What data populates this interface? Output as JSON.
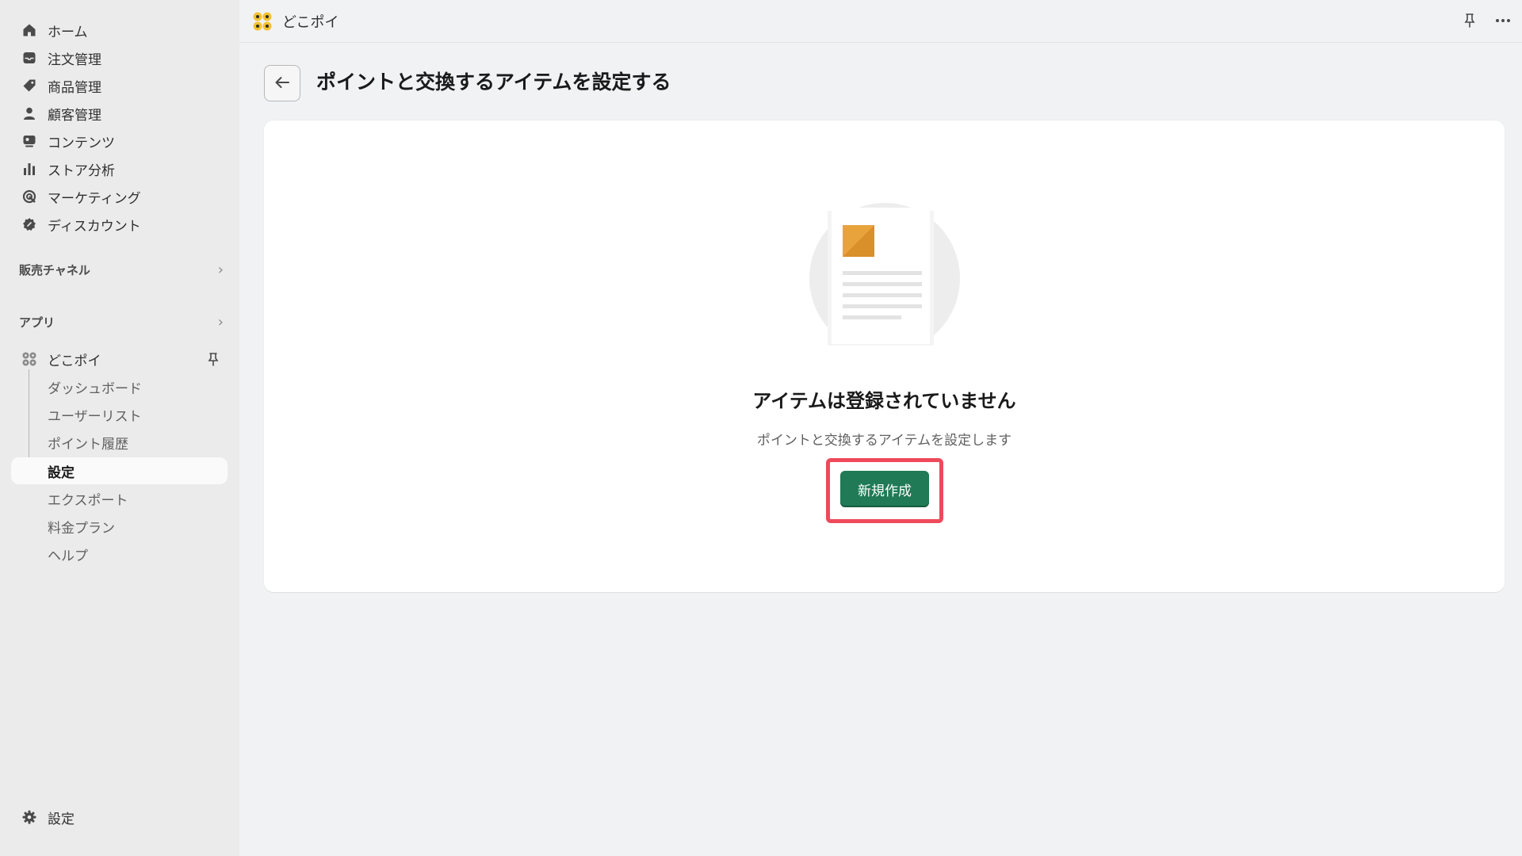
{
  "sidebar": {
    "nav": [
      {
        "label": "ホーム",
        "icon": "home-icon"
      },
      {
        "label": "注文管理",
        "icon": "inbox-icon"
      },
      {
        "label": "商品管理",
        "icon": "tag-icon"
      },
      {
        "label": "顧客管理",
        "icon": "person-icon"
      },
      {
        "label": "コンテンツ",
        "icon": "content-icon"
      },
      {
        "label": "ストア分析",
        "icon": "bar-chart-icon"
      },
      {
        "label": "マーケティング",
        "icon": "target-icon"
      },
      {
        "label": "ディスカウント",
        "icon": "discount-icon"
      }
    ],
    "sales_channels_label": "販売チャネル",
    "apps_label": "アプリ",
    "app": {
      "name": "どこポイ",
      "sub_items": [
        {
          "label": "ダッシュボード"
        },
        {
          "label": "ユーザーリスト"
        },
        {
          "label": "ポイント履歴"
        },
        {
          "label": "設定"
        },
        {
          "label": "エクスポート"
        },
        {
          "label": "料金プラン"
        },
        {
          "label": "ヘルプ"
        }
      ],
      "active_item": "設定"
    },
    "settings_label": "設定"
  },
  "topbar": {
    "app_name": "どこポイ"
  },
  "page": {
    "title": "ポイントと交換するアイテムを設定する",
    "empty_state": {
      "heading": "アイテムは登録されていません",
      "description": "ポイントと交換するアイテムを設定します",
      "primary_button": "新規作成"
    }
  },
  "colors": {
    "primary_button": "#1f7a55",
    "highlight_border": "#ee4a5c",
    "illustration_accent": "#e8a33d"
  }
}
